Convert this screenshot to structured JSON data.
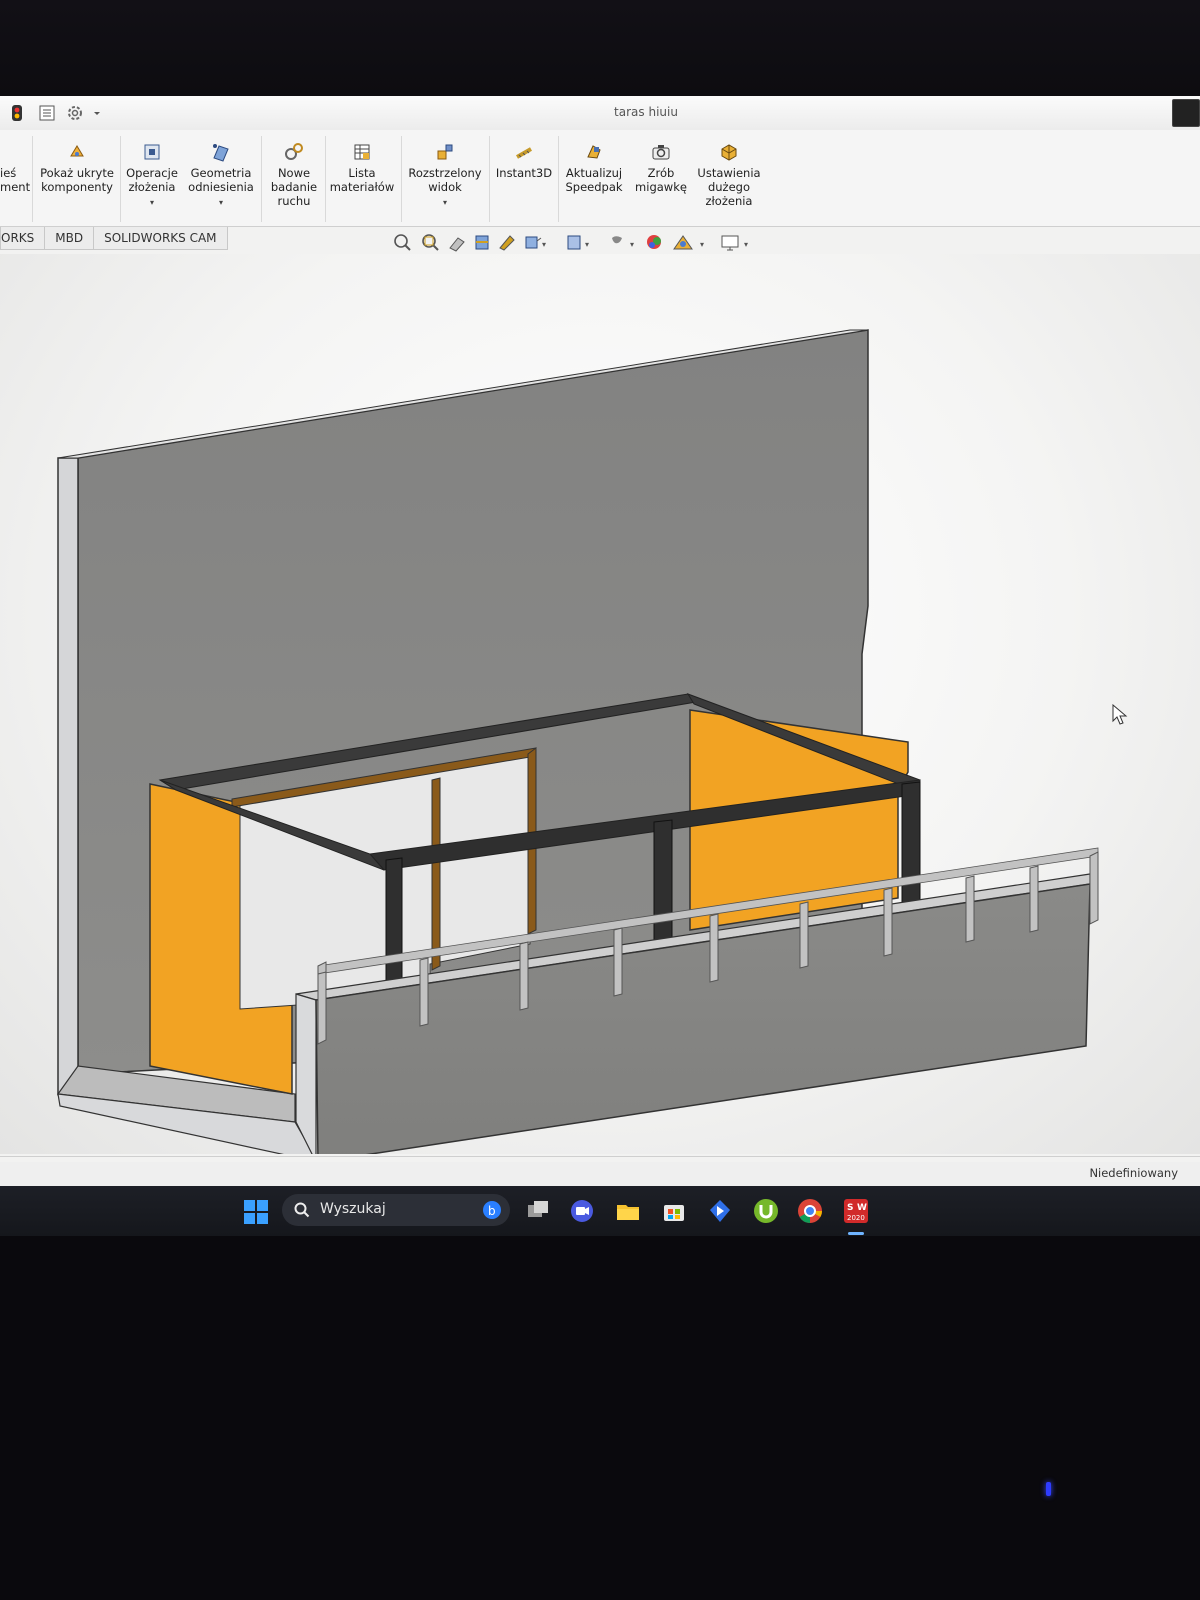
{
  "window": {
    "title": "taras hiuiu"
  },
  "ribbon": {
    "clipped_left": "ieś\nment",
    "buttons": [
      {
        "id": "show-hidden",
        "label": "Pokaż ukryte\nkomponenty",
        "has_caret": false
      },
      {
        "id": "assembly-ops",
        "label": "Operacje\nzłożenia",
        "has_caret": true
      },
      {
        "id": "ref-geometry",
        "label": "Geometria\nodniesienia",
        "has_caret": true
      },
      {
        "id": "new-motion",
        "label": "Nowe\nbadanie\nruchu",
        "has_caret": false
      },
      {
        "id": "bom",
        "label": "Lista\nmateriałów",
        "has_caret": false
      },
      {
        "id": "exploded",
        "label": "Rozstrzelony\nwidok",
        "has_caret": true
      },
      {
        "id": "instant3d",
        "label": "Instant3D",
        "has_caret": false
      },
      {
        "id": "speedpak",
        "label": "Aktualizuj\nSpeedpak",
        "has_caret": false
      },
      {
        "id": "snapshot",
        "label": "Zrób\nmigawkę",
        "has_caret": false
      },
      {
        "id": "large-asm",
        "label": "Ustawienia\ndużego\nzłożenia",
        "has_caret": false
      }
    ]
  },
  "tabs": [
    {
      "label": "ORKS"
    },
    {
      "label": "MBD"
    },
    {
      "label": "SOLIDWORKS CAM"
    }
  ],
  "view_toolbar": {
    "icons": [
      "zoom-to-fit-icon",
      "zoom-area-icon",
      "previous-view-icon",
      "section-view-icon",
      "dynamic-annotation-icon",
      "view-orientation-icon",
      "display-style-icon",
      "hide-show-icon",
      "edit-appearance-icon",
      "apply-scene-icon",
      "view-settings-icon"
    ]
  },
  "status": {
    "text": "Niedefiniowany"
  },
  "taskbar": {
    "search_placeholder": "Wyszukaj",
    "apps": [
      "bing-icon",
      "task-view-icon",
      "meet-icon",
      "file-explorer-icon",
      "store-icon",
      "azure-icon",
      "utorrent-icon",
      "chrome-icon",
      "solidworks-icon"
    ],
    "solidworks_badge": "2020"
  },
  "colors": {
    "orange_panel": "#f2a323",
    "wall_grey": "#8c8c8a",
    "frame_dark": "#3a3a3a",
    "rail_steel": "#b5b5b5"
  }
}
